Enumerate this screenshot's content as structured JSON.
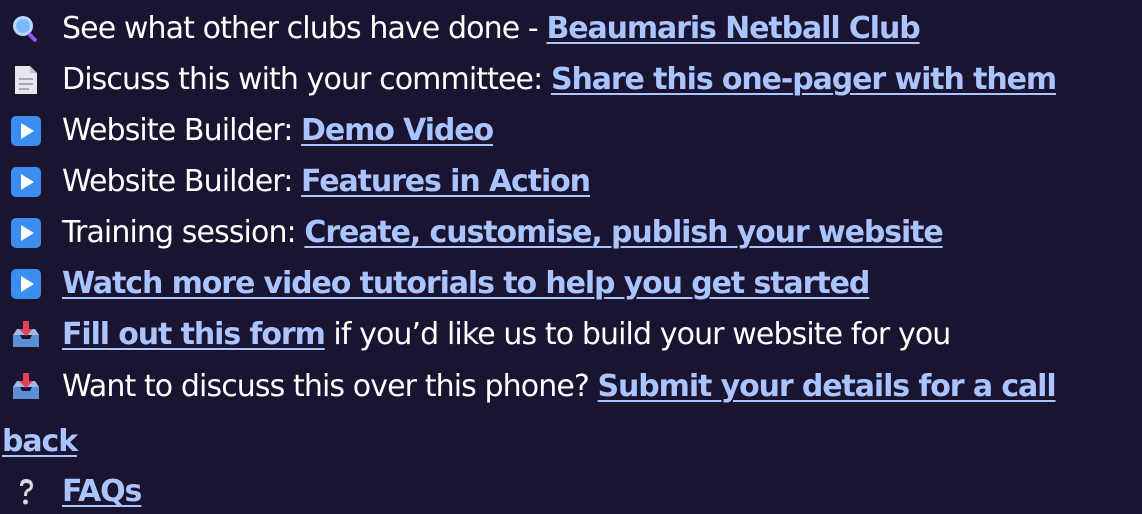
{
  "items": [
    {
      "icon": "magnifying-glass-icon",
      "prefix": "See what other clubs have done - ",
      "link": "Beaumaris Netball Club",
      "suffix": ""
    },
    {
      "icon": "document-icon",
      "prefix": "Discuss this with your committee: ",
      "link": "Share this one-pager with them",
      "suffix": ""
    },
    {
      "icon": "play-button-icon",
      "prefix": "Website Builder: ",
      "link": "Demo Video",
      "suffix": ""
    },
    {
      "icon": "play-button-icon",
      "prefix": "Website Builder: ",
      "link": "Features in Action",
      "suffix": ""
    },
    {
      "icon": "play-button-icon",
      "prefix": "Training session: ",
      "link": "Create, customise, publish your website",
      "suffix": ""
    },
    {
      "icon": "play-button-icon",
      "prefix": "",
      "link": "Watch more video tutorials to help you get started",
      "suffix": ""
    },
    {
      "icon": "inbox-tray-icon",
      "prefix": "",
      "link": "Fill out this form",
      "suffix": " if you’d like us to build your website for you"
    },
    {
      "icon": "inbox-tray-icon",
      "prefix": "Want to discuss this over this phone? ",
      "link": "Submit your details for a call",
      "suffix": ""
    },
    {
      "icon": "question-mark-icon",
      "prefix": "",
      "link": "FAQs",
      "suffix": ""
    }
  ],
  "wrap_text": "back",
  "colors": {
    "background": "#1a1430",
    "text": "#ffffff",
    "link": "#a9c4ff",
    "play": "#3b8ef0",
    "document": "#e7e6ef",
    "inbox": "#5d8fd7",
    "arrow": "#e2405b",
    "question": "#d8d7e0"
  }
}
